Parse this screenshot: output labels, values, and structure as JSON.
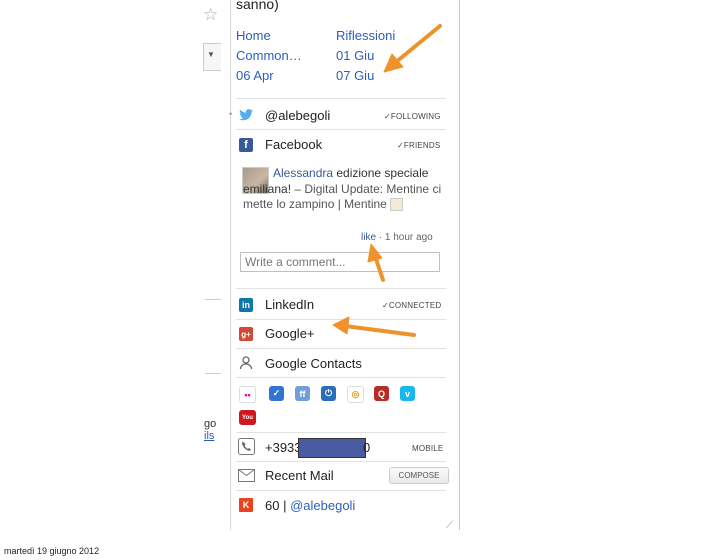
{
  "fragment": {
    "star_icon": "star-icon",
    "line1": "go",
    "line2": "ils"
  },
  "header": {
    "partial_text": "sanno)",
    "links": [
      {
        "label": "Home"
      },
      {
        "label": "Riflessioni"
      },
      {
        "label": "Common…"
      },
      {
        "label": "01 Giu"
      },
      {
        "label": "06 Apr"
      },
      {
        "label": "07 Giu"
      }
    ]
  },
  "rows": {
    "twitter": {
      "label": "@alebegoli",
      "status": "✓FOLLOWING",
      "icon": "twitter-icon",
      "color": "#55acee"
    },
    "facebook": {
      "label": "Facebook",
      "status": "✓FRIENDS",
      "icon": "facebook-icon",
      "color": "#3b5998"
    },
    "linkedin": {
      "label": "LinkedIn",
      "status": "✓CONNECTED",
      "icon": "linkedin-icon",
      "color": "#0e76a8"
    },
    "googleplus": {
      "label": "Google+",
      "icon": "google-plus-icon",
      "color": "#d34836"
    },
    "contacts": {
      "label": "Google Contacts",
      "icon": "contacts-icon"
    },
    "phone": {
      "label": "+3933",
      "tail": "0",
      "status": "MOBILE",
      "icon": "phone-icon"
    },
    "mail": {
      "label": "Recent Mail",
      "button": "COMPOSE",
      "icon": "mail-icon"
    },
    "klout": {
      "score": "60",
      "separator": " | ",
      "handle": "@alebegoli",
      "icon": "klout-icon",
      "color": "#e5461f"
    }
  },
  "facebook_post": {
    "author": "Alessandra",
    "text_dark": " edizione speciale emiliana!",
    "text_rest": " – Digital Update: Mentine ci mette lo zampino | Mentine",
    "like": "like",
    "dot": " · ",
    "time": "1 hour ago",
    "comment_placeholder": "Write a comment..."
  },
  "social_icons": [
    {
      "name": "flickr-icon",
      "glyph": "••",
      "color": "#ffffff",
      "fg": "#ff0084"
    },
    {
      "name": "delicious-icon",
      "glyph": "✓",
      "color": "#3274d1",
      "fg": "#fff"
    },
    {
      "name": "friendfeed-icon",
      "glyph": "ff",
      "color": "#6f9ed9",
      "fg": "#fff"
    },
    {
      "name": "power-icon",
      "glyph": "⏻",
      "color": "#2a6ebb",
      "fg": "#fff"
    },
    {
      "name": "picasa-icon",
      "glyph": "◎",
      "color": "#ffffff",
      "fg": "#e8a01d"
    },
    {
      "name": "quora-icon",
      "glyph": "Q",
      "color": "#b92b27",
      "fg": "#fff"
    },
    {
      "name": "vimeo-icon",
      "glyph": "v",
      "color": "#1ab7ea",
      "fg": "#fff"
    },
    {
      "name": "youtube-icon",
      "glyph": "You",
      "color": "#cc181e",
      "fg": "#fff"
    }
  ],
  "annotations": {
    "arrow_color": "#f0922b"
  },
  "footer": {
    "date": "martedì 19 giugno 2012"
  }
}
